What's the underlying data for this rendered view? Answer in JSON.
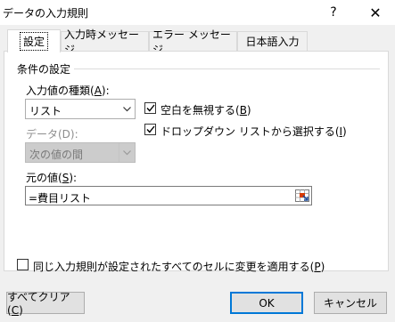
{
  "window": {
    "title": "データの入力規則",
    "help": "?",
    "close": "✕"
  },
  "tabs": [
    {
      "label": "設定",
      "active": true
    },
    {
      "label": "入力時メッセージ",
      "active": false
    },
    {
      "label": "エラー メッセージ",
      "active": false
    },
    {
      "label": "日本語入力",
      "active": false
    }
  ],
  "settings": {
    "group_title": "条件の設定",
    "type_label": "入力値の種類(A):",
    "type_value": "リスト",
    "data_label": "データ(D):",
    "data_value": "次の値の間",
    "ignore_blank_label": "空白を無視する(B)",
    "ignore_blank_checked": true,
    "dropdown_label": "ドロップダウン リストから選択する(I)",
    "dropdown_checked": true,
    "source_label": "元の値(S):",
    "source_value": "=費目リスト",
    "apply_all_label": "同じ入力規則が設定されたすべてのセルに変更を適用する(P)",
    "apply_all_checked": false
  },
  "buttons": {
    "clear_all": "すべてクリア(C)",
    "ok": "OK",
    "cancel": "キャンセル"
  },
  "icons": {
    "help": "question-mark",
    "close": "x-mark",
    "checkbox": "check-mark",
    "dropdown": "chevron-down",
    "range_select": "range-selector"
  }
}
